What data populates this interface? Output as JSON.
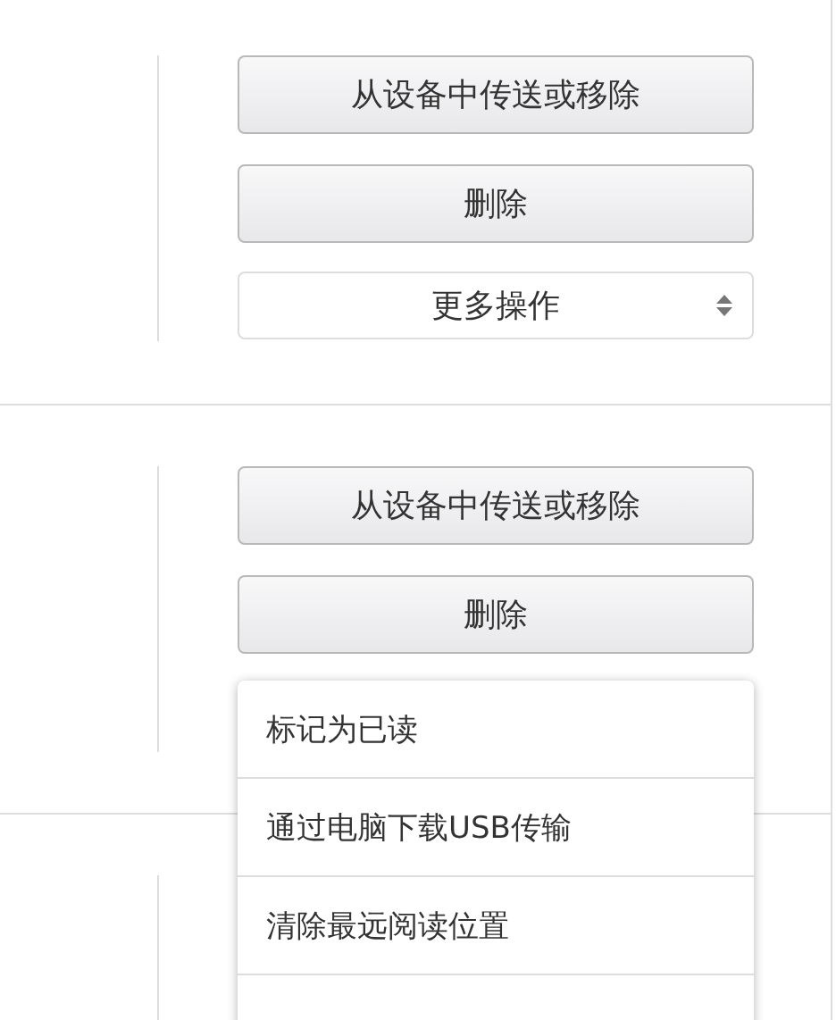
{
  "rows": [
    {
      "buttons": [
        "从设备中传送或移除",
        "删除"
      ],
      "select": {
        "label": "更多操作"
      }
    },
    {
      "buttons": [
        "从设备中传送或移除",
        "删除"
      ],
      "menu": {
        "items": [
          "标记为已读",
          "通过电脑下载USB传输",
          "清除最远阅读位置"
        ]
      }
    }
  ]
}
